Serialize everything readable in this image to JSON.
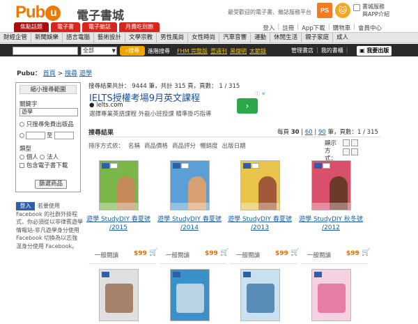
{
  "header": {
    "logo": "Pub",
    "logo_u": "u",
    "logo_sub": "電子書城",
    "slogan": "最受歡迎的電子書、雜誌服務平台",
    "ps_badge": "PS",
    "service_line1": "書城服務",
    "service_line2": "與APP介紹"
  },
  "red_tabs": [
    "焦點話題",
    "電子書",
    "電子雜誌",
    "月費吃到飽"
  ],
  "util_links": [
    "登入",
    "註冊",
    "App下載",
    "購物車",
    "會員中心"
  ],
  "categories": [
    "財經企管",
    "新聞娛樂",
    "語言電腦",
    "藝術設計",
    "文學宗教",
    "男性風尚",
    "女性時尚",
    "汽車音響",
    "運動",
    "休閒生活",
    "親子家庭",
    "成人"
  ],
  "search": {
    "select_value": "全部",
    "button": "搜尋",
    "advanced": "進階搜尋",
    "promos": [
      "FHM 完整版",
      "壹週刊",
      "黑傑明",
      "太節錄"
    ],
    "bookshelf_manage": "管理書店",
    "my_bookshelf": "我的書櫃",
    "sell": "我要出版"
  },
  "breadcrumb": {
    "root": "Pubu：",
    "home": "首頁",
    "sep": ">",
    "search": "搜尋",
    "term": "遊學"
  },
  "sidebar": {
    "title": "縮小搜尋範圍",
    "keyword_label": "關鍵字",
    "keyword_value": "遊學",
    "free_only": "只搜尋免費出版品",
    "price_sep": "至",
    "type_label": "類型",
    "type_person": "個人",
    "type_corp": "法人",
    "include_ebook": "包含電子書下載",
    "filter_button": "篩選商品",
    "login_button": "登入",
    "login_text": "若要使用Facebook 的社群外掛程式，你必須從以非律賓遊學情報站-非凡遊學身分使用Facebook 切換為以志強温身分使用 Facebook。"
  },
  "results": {
    "summary": "搜尋結果共計： 9444 筆，共計 315 頁，頁數： 1 / 315",
    "title": "搜尋結果",
    "per_page_label": "每頁",
    "per_page_30": "30",
    "per_page_60": "60",
    "per_page_90": "90",
    "per_page_tail": "筆，頁數：1 / 315",
    "sort_label": "排序方式依：",
    "sort_options": [
      "名稱",
      "商品價格",
      "商品評分",
      "暢銷度",
      "出版日期"
    ],
    "display_mode": "顯示方式："
  },
  "ad": {
    "title": "IELTS授權考場9月英文課程",
    "url": "ielts.com",
    "desc": "選擇專業英語課程 外能小班授課 精準掛巧指導",
    "arrow": "›",
    "i": "ⓘ ✕"
  },
  "products": [
    {
      "title": "遊學 StudyDIY 春夏號 /2015",
      "cat": "一般閱讀",
      "price": "$99",
      "cover_color": "#7ab648",
      "figure_color": "#c48a5a"
    },
    {
      "title": "遊學 StudyDIY 春夏號 /2014",
      "cat": "一般閱讀",
      "price": "$99",
      "cover_color": "#5aa0d6",
      "figure_color": "#d8a070"
    },
    {
      "title": "遊學 StudyDIY 春夏號 /2013",
      "cat": "一般閱讀",
      "price": "$99",
      "cover_color": "#e8c44a",
      "figure_color": "#a05a3a"
    },
    {
      "title": "遊學 StudyDIY 秋冬號 /2012",
      "cat": "一般閱讀",
      "price": "$99",
      "cover_color": "#d8506a",
      "figure_color": "#6a3a2a"
    }
  ],
  "products_row2": [
    {
      "cover_color": "#e0e0e0",
      "accent": "#8a5a3a"
    },
    {
      "cover_color": "#3a90c8",
      "accent": "#f0f0f0"
    },
    {
      "cover_color": "#c8e0f0",
      "accent": "#2a6aa0"
    },
    {
      "cover_color": "#f4d0e0",
      "accent": "#e05a8a"
    }
  ],
  "cart_icon": "🛒"
}
